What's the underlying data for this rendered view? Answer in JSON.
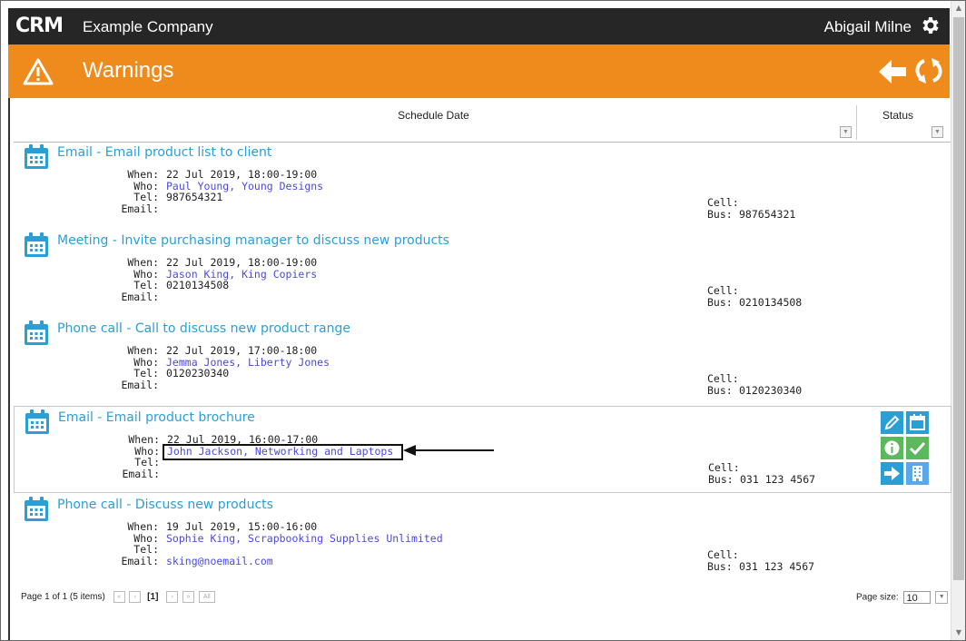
{
  "app": {
    "logo_text": "CRM",
    "company": "Example Company",
    "user": "Abigail Milne"
  },
  "page": {
    "title": "Warnings"
  },
  "grid": {
    "col_schedule": "Schedule Date",
    "col_status": "Status"
  },
  "labels": {
    "when": "When:",
    "who": "Who:",
    "tel": "Tel:",
    "email": "Email:",
    "cell": "Cell:",
    "bus": "Bus:"
  },
  "rows": [
    {
      "title": "Email - Email product list to client",
      "when": "22 Jul 2019, 18:00-19:00",
      "who": "Paul Young, Young Designs",
      "tel": "987654321",
      "email": "",
      "cell": "",
      "bus": "987654321"
    },
    {
      "title": "Meeting - Invite purchasing manager to discuss new products",
      "when": "22 Jul 2019, 18:00-19:00",
      "who": "Jason King, King Copiers",
      "tel": "0210134508",
      "email": "",
      "cell": "",
      "bus": "0210134508"
    },
    {
      "title": "Phone call - Call to discuss new product range",
      "when": "22 Jul 2019, 17:00-18:00",
      "who": "Jemma Jones, Liberty Jones",
      "tel": "0120230340",
      "email": "",
      "cell": "",
      "bus": "0120230340"
    },
    {
      "title": "Email - Email product brochure",
      "when": "22 Jul 2019, 16:00-17:00",
      "who": "John Jackson, Networking and Laptops",
      "tel": "",
      "email": "",
      "cell": "",
      "bus": "031 123 4567"
    },
    {
      "title": "Phone call - Discuss new products",
      "when": "19 Jul 2019, 15:00-16:00",
      "who": "Sophie King, Scrapbooking Supplies Unlimited",
      "tel": "",
      "email": "sking@noemail.com",
      "cell": "",
      "bus": "031 123 4567"
    }
  ],
  "pager": {
    "info": "Page 1 of 1 (5 items)",
    "current": "[1]",
    "first": "«",
    "prev": "‹",
    "next": "›",
    "last": "»",
    "all": "All",
    "size_label": "Page size:",
    "size_value": "10"
  },
  "colors": {
    "topbar": "#262626",
    "accent": "#ef8b1c",
    "title_link": "#2a9fd6",
    "person_link": "#4a4ae0",
    "btn_blue": "#2a9fd6",
    "btn_green": "#5cb85c"
  },
  "icons": [
    "crm-logo",
    "gear-icon",
    "warning-icon",
    "back-arrow-icon",
    "refresh-icon",
    "calendar-icon",
    "edit-pencil-icon",
    "calendar-small-icon",
    "info-icon",
    "check-icon",
    "arrow-right-icon",
    "building-icon",
    "annotation-arrow"
  ]
}
